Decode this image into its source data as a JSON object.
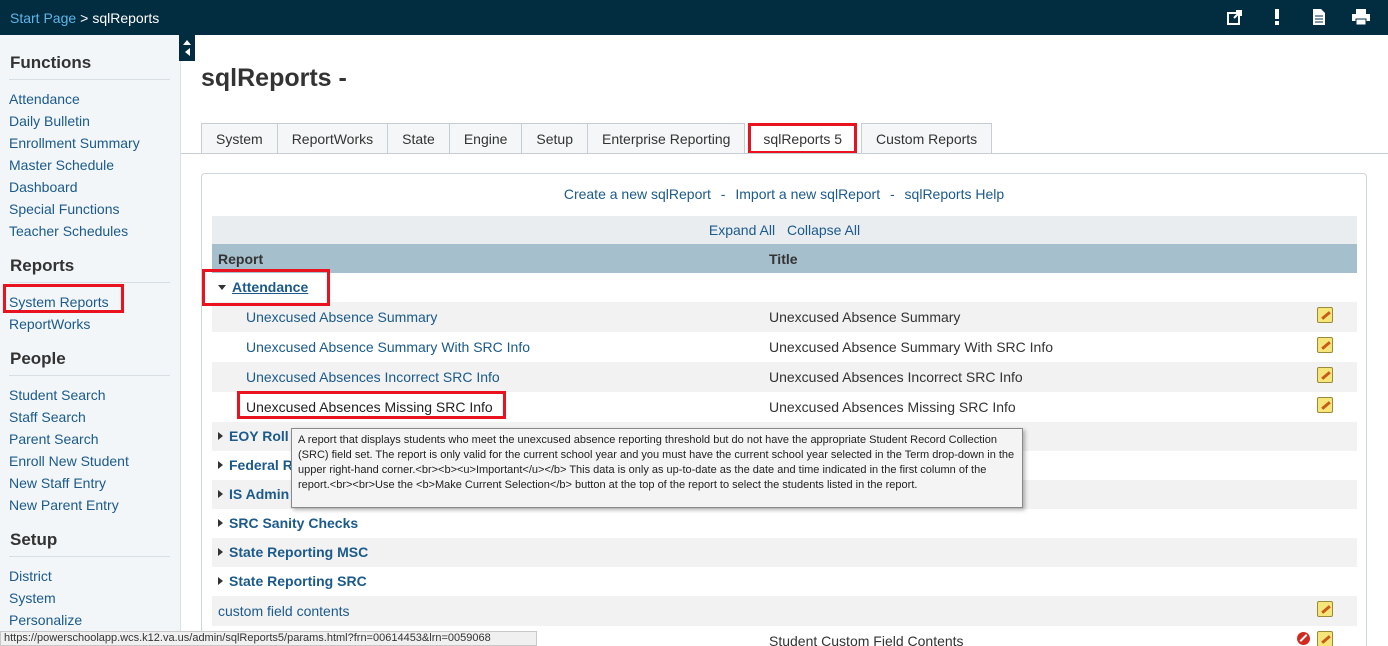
{
  "breadcrumb": {
    "start": "Start Page",
    "sep": ">",
    "current": "sqlReports"
  },
  "top_icons": [
    "external-link-icon",
    "alert-icon",
    "document-icon",
    "print-icon"
  ],
  "sidebar": {
    "functions": {
      "title": "Functions",
      "items": [
        "Attendance",
        "Daily Bulletin",
        "Enrollment Summary",
        "Master Schedule",
        "Dashboard",
        "Special Functions",
        "Teacher Schedules"
      ]
    },
    "reports": {
      "title": "Reports",
      "items": [
        "System Reports",
        "ReportWorks"
      ]
    },
    "people": {
      "title": "People",
      "items": [
        "Student Search",
        "Staff Search",
        "Parent Search",
        "Enroll New Student",
        "New Staff Entry",
        "New Parent Entry"
      ]
    },
    "setup": {
      "title": "Setup",
      "items": [
        "District",
        "System",
        "Personalize"
      ]
    }
  },
  "main": {
    "title": "sqlReports -",
    "tabs": [
      "System",
      "ReportWorks",
      "State",
      "Engine",
      "Setup",
      "Enterprise Reporting",
      "sqlReports 5",
      "Custom Reports"
    ],
    "links": {
      "create": "Create a new sqlReport",
      "import": "Import a new sqlReport",
      "help": "sqlReports Help",
      "dash": "-"
    },
    "expand": {
      "expand_all": "Expand All",
      "collapse_all": "Collapse All"
    },
    "columns": {
      "report": "Report",
      "title": "Title"
    },
    "group_attendance": "Attendance",
    "attendance_reports": [
      {
        "report": "Unexcused Absence Summary",
        "title": "Unexcused Absence Summary"
      },
      {
        "report": "Unexcused Absence Summary With SRC Info",
        "title": "Unexcused Absence Summary With SRC Info"
      },
      {
        "report": "Unexcused Absences Incorrect SRC Info",
        "title": "Unexcused Absences Incorrect SRC Info"
      },
      {
        "report": "Unexcused Absences Missing SRC Info",
        "title": "Unexcused Absences Missing SRC Info"
      }
    ],
    "groups": [
      "EOY Roll",
      "Federal R",
      "IS Admin",
      "SRC Sanity Checks",
      "State Reporting MSC",
      "State Reporting SRC"
    ],
    "custom_row": {
      "report": "custom field contents"
    },
    "last_row": {
      "title": "Student Custom Field Contents"
    }
  },
  "tooltip": "A report that displays students who meet the unexcused absence reporting threshold but do not have the appropriate Student Record Collection (SRC) field set.  The report is only valid for the current school year and you must have the current school year selected in the Term drop-down in the upper right-hand corner.<br><b><u>Important</u></b> This data is only as up-to-date as the date and time indicated in the first column of the report.<br><br>Use the <b>Make Current Selection</b> button at the top of the report to select the students listed in the report.",
  "status_url": "https://powerschoolapp.wcs.k12.va.us/admin/sqlReports5/params.html?frn=00614453&lrn=0059068"
}
